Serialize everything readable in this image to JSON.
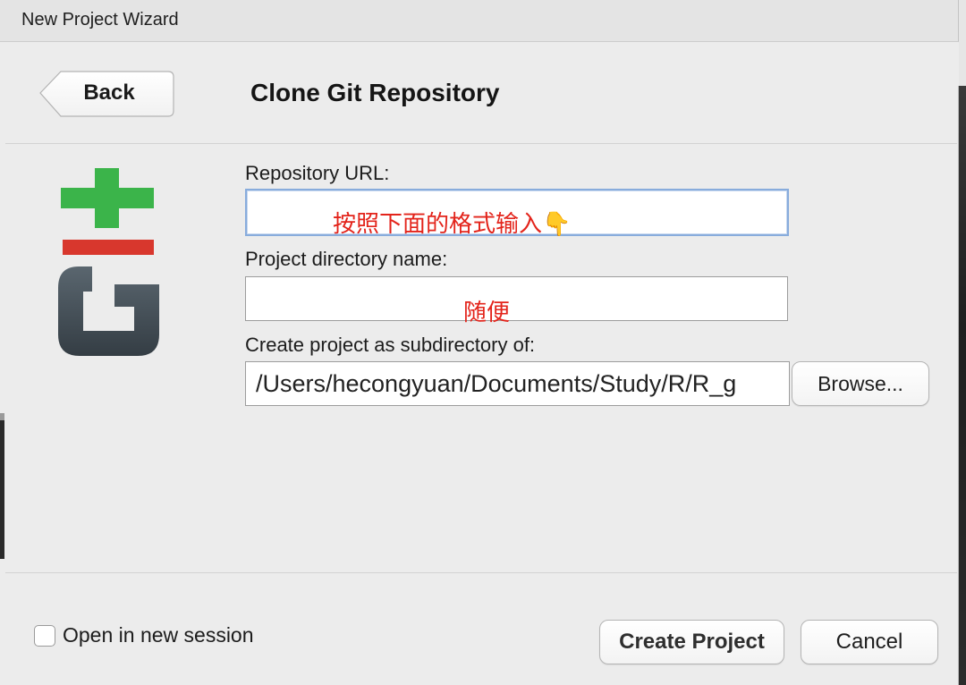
{
  "window": {
    "title": "New Project Wizard"
  },
  "header": {
    "back_label": "Back",
    "title": "Clone Git Repository"
  },
  "logo": {
    "icon": "git-logo-icon"
  },
  "form": {
    "repo_url": {
      "label": "Repository URL:",
      "focused": true,
      "annotation": "按照下面的格式输入👇"
    },
    "dir_name": {
      "label": "Project directory name:",
      "annotation": "随便"
    },
    "subdir": {
      "label": "Create project as subdirectory of:",
      "value": "/Users/hecongyuan/Documents/Study/R/R_g",
      "browse_label": "Browse..."
    }
  },
  "footer": {
    "checkbox_label": "Open in new session",
    "checkbox_checked": false,
    "create_label": "Create Project",
    "cancel_label": "Cancel"
  },
  "colors": {
    "focus_border": "#88acdc",
    "annotation_text": "#e3241b",
    "git_plus": "#3bb44a",
    "git_bar": "#d8372d",
    "git_g": "#414c55"
  }
}
